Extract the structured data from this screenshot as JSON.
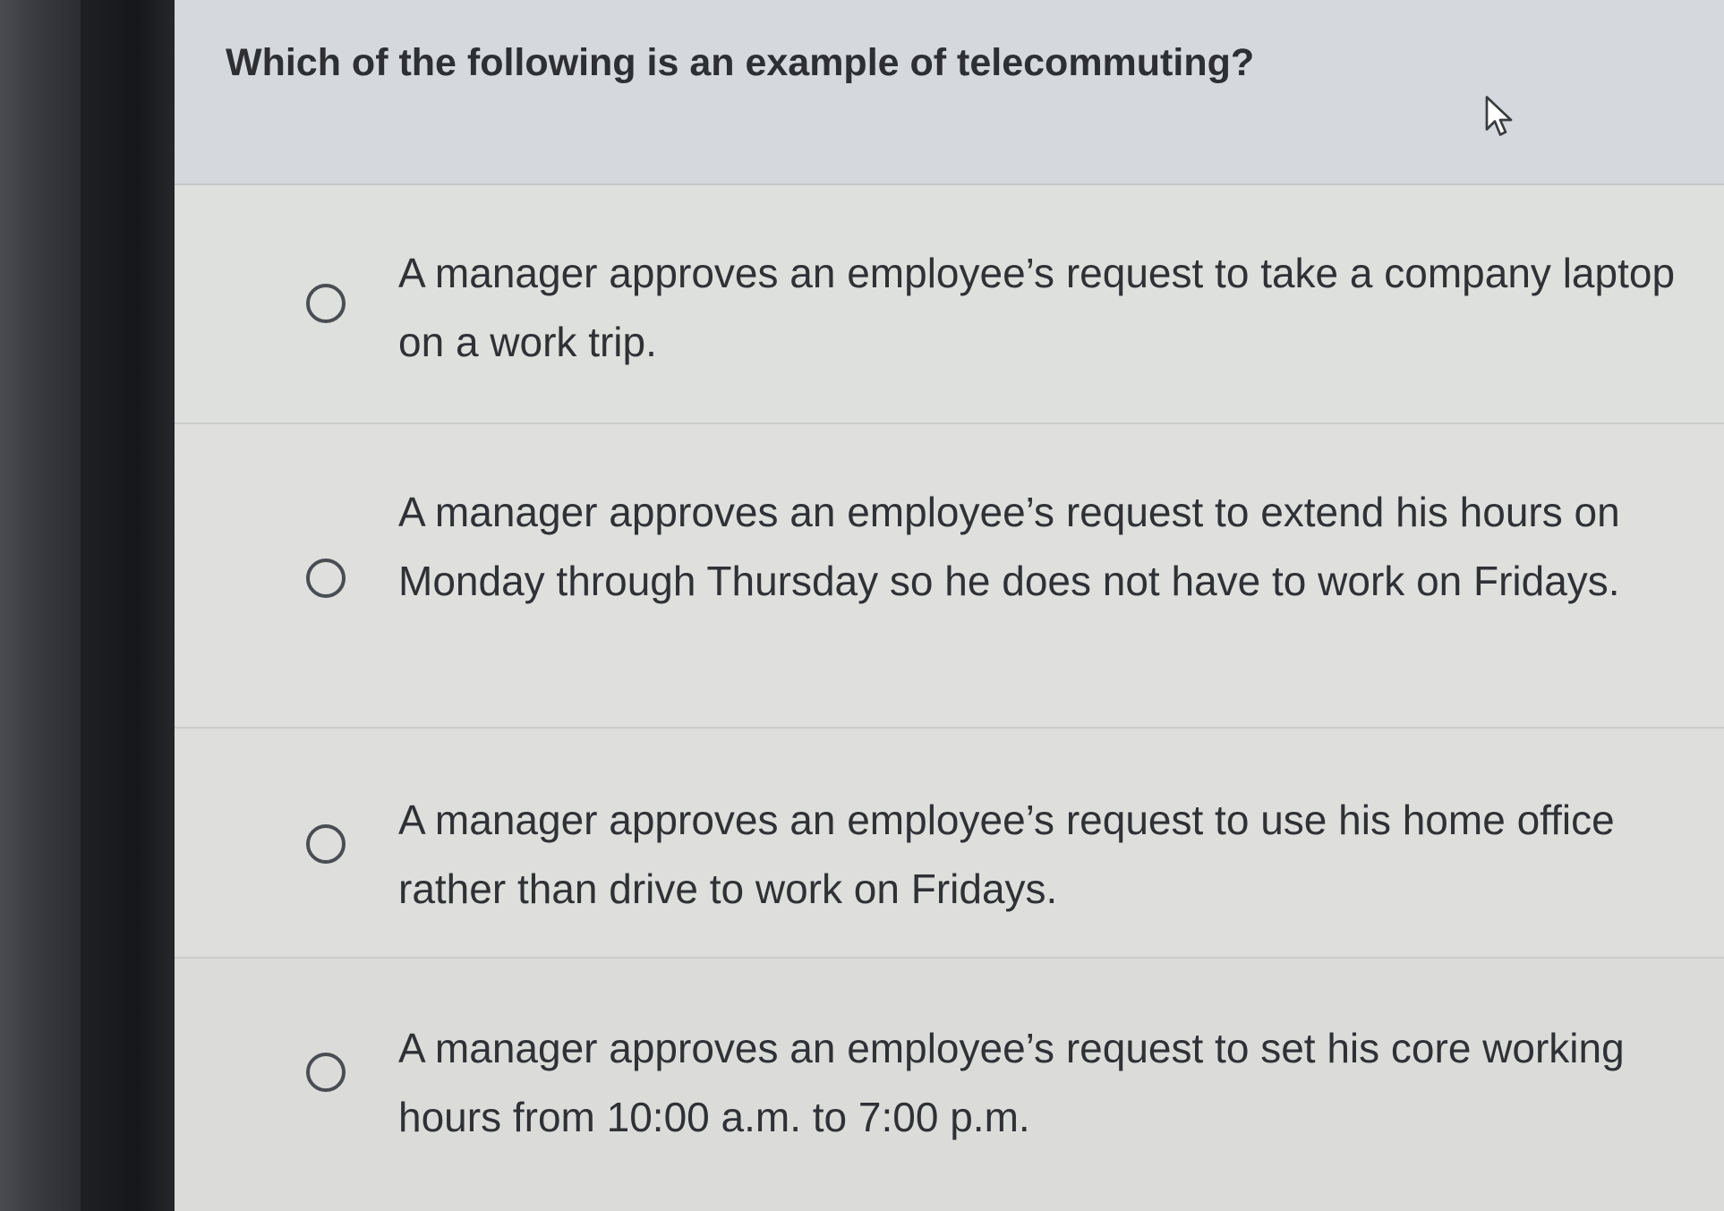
{
  "question": {
    "text": "Which of the following is an example of telecommuting?"
  },
  "options": [
    {
      "label": "A manager approves an employee’s request to take a company laptop on a work trip.",
      "selected": false
    },
    {
      "label": "A manager approves an employee’s request to extend his hours on Monday through Thursday so he does not have to work on Fridays.",
      "selected": false
    },
    {
      "label": "A manager approves an employee’s request to use his home office rather than drive to work on Fridays.",
      "selected": false
    },
    {
      "label": "A manager approves an employee’s request to set his core working hours from 10:00 a.m. to 7:00 p.m.",
      "selected": false
    }
  ],
  "icons": {
    "cursor": "mouse-pointer-icon",
    "radio": "radio-unselected-icon"
  },
  "colors": {
    "text": "#2f3135",
    "radio_border": "#4a4d52",
    "panel_bg": "#dcdedd",
    "header_bg": "#d5d8dc"
  }
}
